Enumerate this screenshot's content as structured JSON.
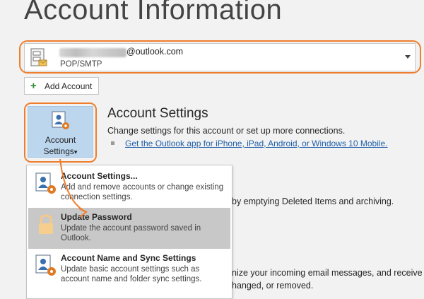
{
  "page": {
    "title": "Account Information"
  },
  "account_selector": {
    "email_domain": "@outlook.com",
    "account_type": "POP/SMTP"
  },
  "toolbar": {
    "add_account_label": "Add Account"
  },
  "account_settings_button": {
    "line1": "Account",
    "line2": "Settings",
    "caret": "▾"
  },
  "account_settings_section": {
    "title": "Account Settings",
    "description": "Change settings for this account or set up more connections.",
    "link": "Get the Outlook app for iPhone, iPad, Android, or Windows 10 Mobile."
  },
  "background_text": {
    "cleanup": "by emptying Deleted Items and archiving.",
    "rules_1": "nize your incoming email messages, and receive",
    "rules_2": "hanged, or removed."
  },
  "menu": {
    "items": [
      {
        "title": "Account Settings...",
        "description": "Add and remove accounts or change existing connection settings."
      },
      {
        "title": "Update Password",
        "description": "Update the account password saved in Outlook."
      },
      {
        "title": "Account Name and Sync Settings",
        "description": "Update basic account settings such as account name and folder sync settings."
      }
    ]
  },
  "colors": {
    "highlight": "#ef7d2d",
    "button_bg": "#bcd6ee",
    "link": "#1f5fa8",
    "menu_hover": "#c8c8c8"
  },
  "icons": {
    "account": "account-settings-icon",
    "lock": "lock-icon",
    "plus": "plus-icon",
    "caret": "chevron-down-icon"
  }
}
